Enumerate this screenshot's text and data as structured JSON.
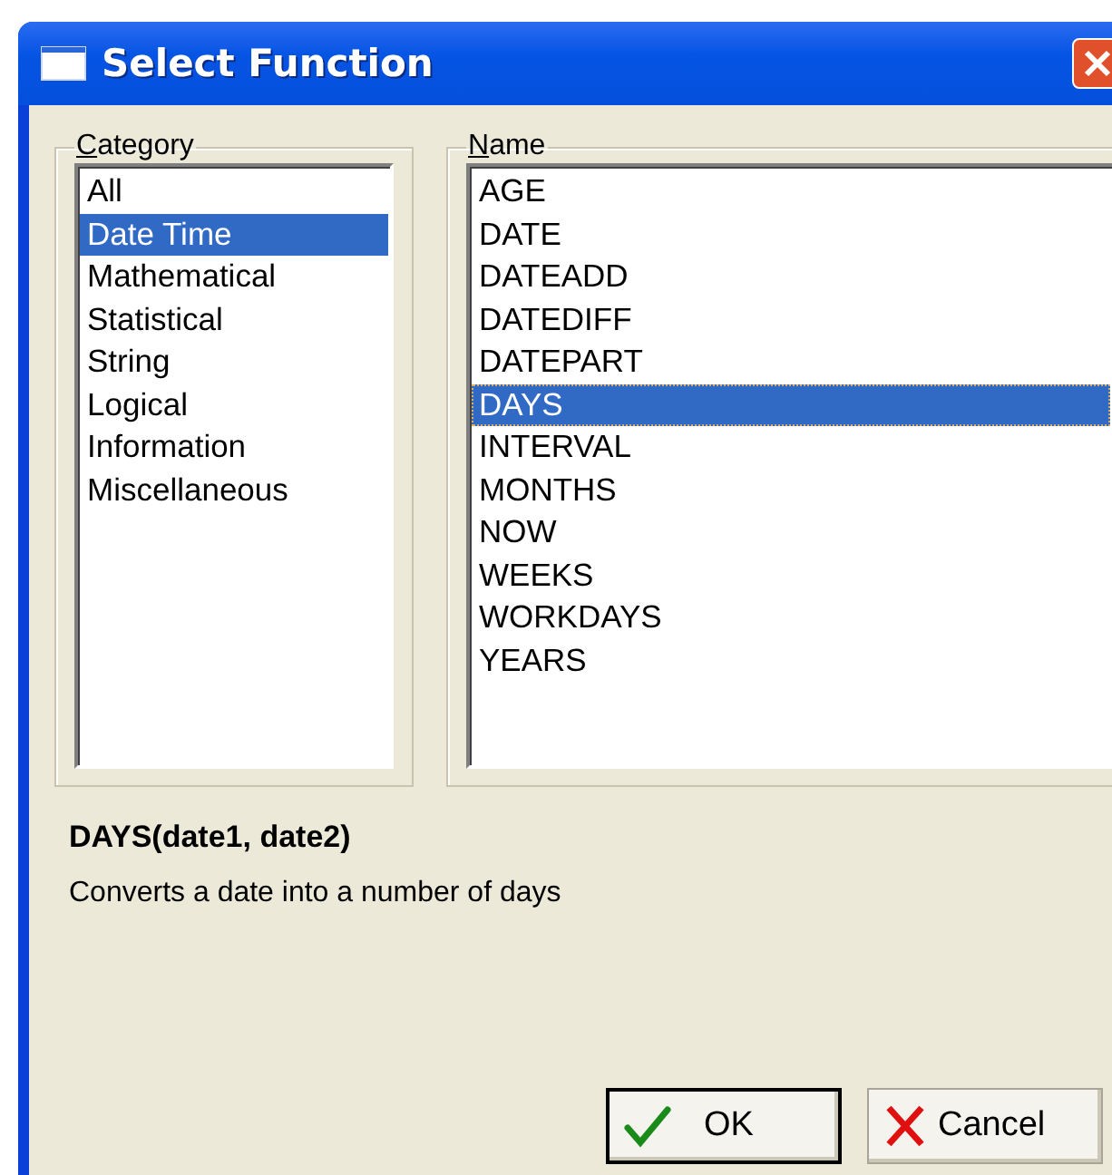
{
  "window": {
    "title": "Select Function"
  },
  "category": {
    "label": "Category",
    "items": [
      {
        "label": "All",
        "selected": false
      },
      {
        "label": "Date Time",
        "selected": true
      },
      {
        "label": "Mathematical",
        "selected": false
      },
      {
        "label": "Statistical",
        "selected": false
      },
      {
        "label": "String",
        "selected": false
      },
      {
        "label": "Logical",
        "selected": false
      },
      {
        "label": "Information",
        "selected": false
      },
      {
        "label": "Miscellaneous",
        "selected": false
      }
    ]
  },
  "name": {
    "label": "Name",
    "items": [
      {
        "label": "AGE",
        "selected": false
      },
      {
        "label": "DATE",
        "selected": false
      },
      {
        "label": "DATEADD",
        "selected": false
      },
      {
        "label": "DATEDIFF",
        "selected": false
      },
      {
        "label": "DATEPART",
        "selected": false
      },
      {
        "label": "DAYS",
        "selected": true
      },
      {
        "label": "INTERVAL",
        "selected": false
      },
      {
        "label": "MONTHS",
        "selected": false
      },
      {
        "label": "NOW",
        "selected": false
      },
      {
        "label": "WEEKS",
        "selected": false
      },
      {
        "label": "WORKDAYS",
        "selected": false
      },
      {
        "label": "YEARS",
        "selected": false
      }
    ]
  },
  "description": {
    "signature": "DAYS(date1, date2)",
    "text": "Converts a date into a number of days"
  },
  "buttons": [
    {
      "kind": "ok",
      "label": "OK"
    },
    {
      "kind": "cancel",
      "label": "Cancel"
    }
  ]
}
